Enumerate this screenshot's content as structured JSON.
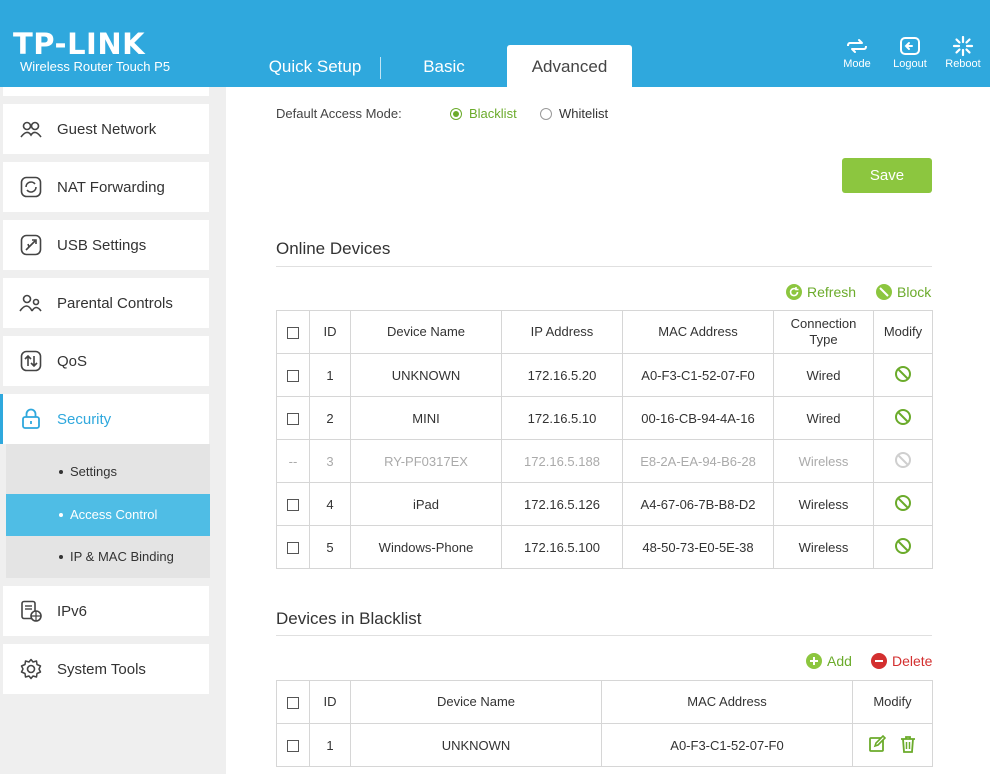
{
  "header": {
    "logo": "TP-LINK",
    "model": "Wireless Router Touch P5",
    "tabs": [
      {
        "label": "Quick Setup"
      },
      {
        "label": "Basic"
      },
      {
        "label": "Advanced"
      }
    ],
    "buttons": {
      "mode": "Mode",
      "logout": "Logout",
      "reboot": "Reboot"
    }
  },
  "sidebar": {
    "items": [
      {
        "label": "Guest Network",
        "icon": "guest-network-icon"
      },
      {
        "label": "NAT Forwarding",
        "icon": "nat-forwarding-icon"
      },
      {
        "label": "USB Settings",
        "icon": "usb-icon"
      },
      {
        "label": "Parental Controls",
        "icon": "parental-controls-icon"
      },
      {
        "label": "QoS",
        "icon": "qos-icon"
      },
      {
        "label": "Security",
        "icon": "lock-icon"
      },
      {
        "label": "IPv6",
        "icon": "ipv6-icon"
      },
      {
        "label": "System Tools",
        "icon": "gear-icon"
      }
    ],
    "security_sub": [
      {
        "label": "Settings"
      },
      {
        "label": "Access Control"
      },
      {
        "label": "IP & MAC Binding"
      }
    ]
  },
  "access_mode": {
    "label": "Default Access Mode:",
    "blacklist": "Blacklist",
    "whitelist": "Whitelist",
    "selected": "Blacklist"
  },
  "save_label": "Save",
  "online": {
    "title": "Online Devices",
    "refresh": "Refresh",
    "block": "Block",
    "headers": {
      "id": "ID",
      "name": "Device Name",
      "ip": "IP Address",
      "mac": "MAC Address",
      "conn1": "Connection",
      "conn2": "Type",
      "modify": "Modify"
    },
    "rows": [
      {
        "check": "",
        "id": "1",
        "name": "UNKNOWN",
        "ip": "172.16.5.20",
        "mac": "A0-F3-C1-52-07-F0",
        "type": "Wired"
      },
      {
        "check": "",
        "id": "2",
        "name": "MINI",
        "ip": "172.16.5.10",
        "mac": "00-16-CB-94-4A-16",
        "type": "Wired"
      },
      {
        "check": "--",
        "id": "3",
        "name": "RY-PF0317EX",
        "ip": "172.16.5.188",
        "mac": "E8-2A-EA-94-B6-28",
        "type": "Wireless"
      },
      {
        "check": "",
        "id": "4",
        "name": "iPad",
        "ip": "172.16.5.126",
        "mac": "A4-67-06-7B-B8-D2",
        "type": "Wireless"
      },
      {
        "check": "",
        "id": "5",
        "name": "Windows-Phone",
        "ip": "172.16.5.100",
        "mac": "48-50-73-E0-5E-38",
        "type": "Wireless"
      }
    ]
  },
  "blacklist": {
    "title": "Devices in Blacklist",
    "add": "Add",
    "delete": "Delete",
    "headers": {
      "id": "ID",
      "name": "Device Name",
      "mac": "MAC Address",
      "modify": "Modify"
    },
    "rows": [
      {
        "id": "1",
        "name": "UNKNOWN",
        "mac": "A0-F3-C1-52-07-F0"
      }
    ]
  },
  "colors": {
    "brand": "#2fa8dd",
    "accent_green": "#8cc63f",
    "delete_red": "#d32f2f"
  }
}
